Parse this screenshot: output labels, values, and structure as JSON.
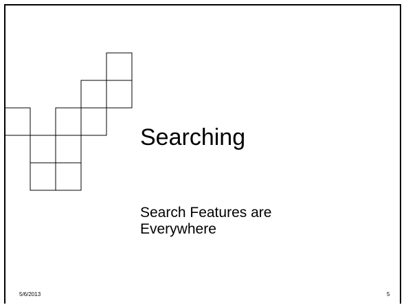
{
  "slide": {
    "title": "Searching",
    "subtitle_line1": "Search Features are",
    "subtitle_line2": "Everywhere",
    "date": "5/6/2013",
    "page_number": "5"
  },
  "colors": {
    "background": "#ffffff",
    "line": "#000000",
    "text": "#000000"
  }
}
